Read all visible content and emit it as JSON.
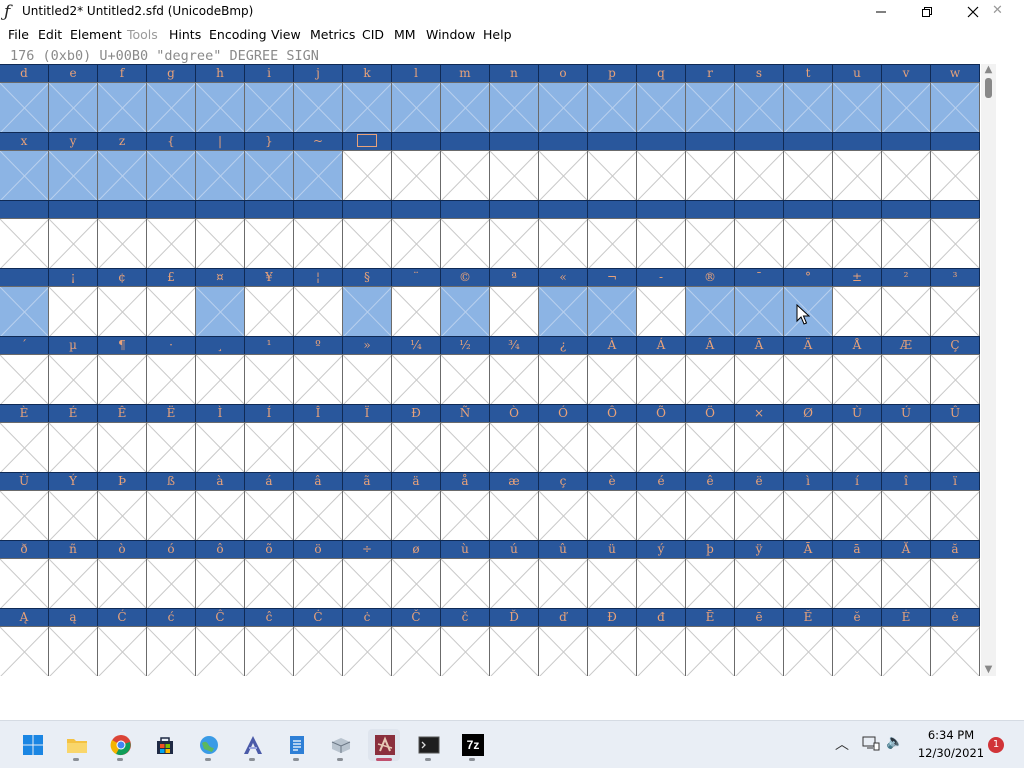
{
  "window": {
    "title": "Untitled2*  Untitled2.sfd (UnicodeBmp)",
    "minimize_icon": "minimize-icon",
    "maximize_icon": "maximize-icon",
    "close_icon": "close-icon"
  },
  "menu": [
    "File",
    "Edit",
    "Element",
    "Tools",
    "Hints",
    "Encoding",
    "View",
    "Metrics",
    "CID",
    "MM",
    "Window",
    "Help"
  ],
  "menu_disabled": [
    "Tools"
  ],
  "glyph_info": "176 (0xb0) U+00B0 \"degree\" DEGREE SIGN",
  "fontview": {
    "rows": [
      {
        "labels": [
          "d",
          "e",
          "f",
          "g",
          "h",
          "i",
          "j",
          "k",
          "l",
          "m",
          "n",
          "o",
          "p",
          "q",
          "r",
          "s",
          "t",
          "u",
          "v",
          "w"
        ],
        "selected": [
          0,
          1,
          2,
          3,
          4,
          5,
          6,
          7,
          8,
          9,
          10,
          11,
          12,
          13,
          14,
          15,
          16,
          17,
          18,
          19
        ]
      },
      {
        "labels": [
          "x",
          "y",
          "z",
          "{",
          "|",
          "}",
          "~",
          "NOTDEF",
          "",
          "",
          "",
          "",
          "",
          "",
          "",
          "",
          "",
          "",
          "",
          ""
        ],
        "selected": [
          0,
          1,
          2,
          3,
          4,
          5,
          6
        ]
      },
      {
        "labels": [
          "",
          "",
          "",
          "",
          "",
          "",
          "",
          "",
          "",
          "",
          "",
          "",
          "",
          "",
          "",
          "",
          "",
          "",
          "",
          ""
        ],
        "selected": []
      },
      {
        "labels": [
          "",
          "¡",
          "¢",
          "£",
          "¤",
          "¥",
          "¦",
          "§",
          "¨",
          "©",
          "ª",
          "«",
          "¬",
          "-",
          "®",
          "¯",
          "°",
          "±",
          "²",
          "³"
        ],
        "selected": [
          0,
          4,
          7,
          9,
          11,
          12,
          14,
          15,
          16
        ]
      },
      {
        "labels": [
          "´",
          "µ",
          "¶",
          "·",
          "¸",
          "¹",
          "º",
          "»",
          "¼",
          "½",
          "¾",
          "¿",
          "À",
          "Á",
          "Â",
          "Ã",
          "Ä",
          "Å",
          "Æ",
          "Ç"
        ],
        "selected": []
      },
      {
        "labels": [
          "È",
          "É",
          "Ê",
          "Ë",
          "Ì",
          "Í",
          "Î",
          "Ï",
          "Ð",
          "Ñ",
          "Ò",
          "Ó",
          "Ô",
          "Õ",
          "Ö",
          "×",
          "Ø",
          "Ù",
          "Ú",
          "Û"
        ],
        "selected": []
      },
      {
        "labels": [
          "Ü",
          "Ý",
          "Þ",
          "ß",
          "à",
          "á",
          "â",
          "ã",
          "ä",
          "å",
          "æ",
          "ç",
          "è",
          "é",
          "ê",
          "ë",
          "ì",
          "í",
          "î",
          "ï"
        ],
        "selected": []
      },
      {
        "labels": [
          "ð",
          "ñ",
          "ò",
          "ó",
          "ô",
          "õ",
          "ö",
          "÷",
          "ø",
          "ù",
          "ú",
          "û",
          "ü",
          "ý",
          "þ",
          "ÿ",
          "Ā",
          "ā",
          "Ă",
          "ă"
        ],
        "selected": []
      },
      {
        "labels": [
          "Ą",
          "ą",
          "Ć",
          "ć",
          "Ĉ",
          "ĉ",
          "Ċ",
          "ċ",
          "Č",
          "č",
          "Ď",
          "ď",
          "Đ",
          "đ",
          "Ē",
          "ē",
          "Ĕ",
          "ĕ",
          "Ė",
          "ė"
        ],
        "selected": []
      }
    ]
  },
  "scrollbar": {
    "up_icon": "scroll-up-icon",
    "down_icon": "scroll-down-icon"
  },
  "taskbar": {
    "apps": [
      "start-icon",
      "file-explorer-icon",
      "chrome-icon",
      "store-icon",
      "network-globe-icon",
      "fontforge-icon",
      "notepad-icon",
      "app-icon",
      "fontforge-active-icon",
      "terminal-icon",
      "7zip-icon"
    ],
    "time": "6:34 PM",
    "date": "12/30/2021",
    "notification_count": "1",
    "sevenzip_label": "7z"
  },
  "colors": {
    "label_band": "#29579c",
    "label_text": "#e8a27a",
    "selected_cell": "#8cb4e4",
    "cross": "#c9c9c9"
  }
}
